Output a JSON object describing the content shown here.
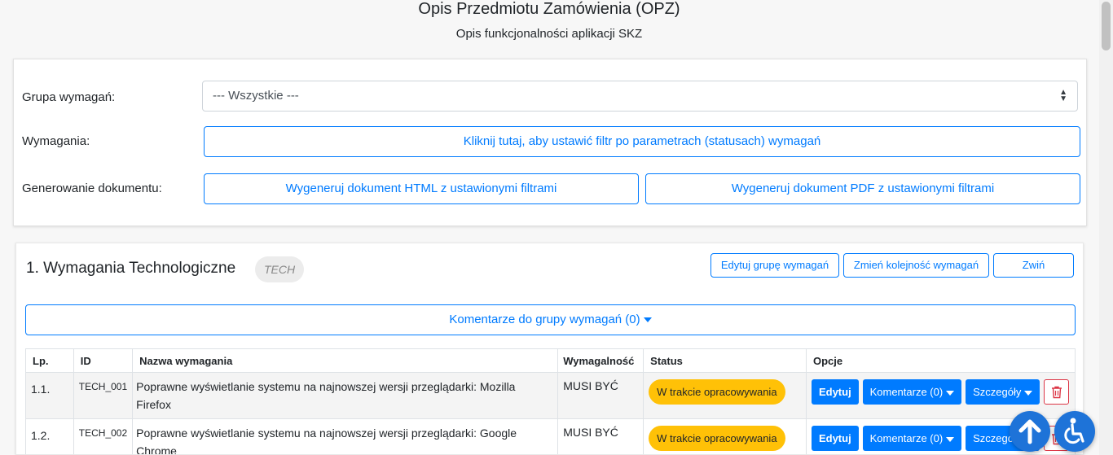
{
  "header": {
    "title": "Opis Przedmiotu Zamówienia (OPZ)",
    "subtitle": "Opis funkcjonalności aplikacji SKZ"
  },
  "filters": {
    "group_label": "Grupa wymagań:",
    "group_select_value": "--- Wszystkie ---",
    "requirements_label": "Wymagania:",
    "requirements_filter_button": "Kliknij tutaj, aby ustawić filtr po parametrach (statusach) wymagań",
    "generate_label": "Generowanie dokumentu:",
    "generate_html_button": "Wygeneruj dokument HTML z ustawionymi filtrami",
    "generate_pdf_button": "Wygeneruj dokument PDF z ustawionymi filtrami"
  },
  "group": {
    "title": "1. Wymagania Technologiczne",
    "badge": "TECH",
    "edit_button": "Edytuj grupę wymagań",
    "reorder_button": "Zmień kolejność wymagań",
    "collapse_button": "Zwiń",
    "comments_button": "Komentarze do grupy wymagań (0)"
  },
  "table": {
    "columns": [
      "Lp.",
      "ID",
      "Nazwa wymagania",
      "Wymagalność",
      "Status",
      "Opcje"
    ],
    "rows": [
      {
        "lp": "1.1.",
        "id": "TECH_001",
        "name": "Poprawne wyświetlanie systemu na najnowszej wersji przeglądarki: Mozilla Firefox",
        "requirement": "MUSI BYĆ",
        "status": "W trakcie opracowywania",
        "edit": "Edytuj",
        "comments": "Komentarze (0)",
        "details": "Szczegóły"
      },
      {
        "lp": "1.2.",
        "id": "TECH_002",
        "name": "Poprawne wyświetlanie systemu na najnowszej wersji przeglądarki: Google Chrome",
        "requirement": "MUSI BYĆ",
        "status": "W trakcie opracowywania",
        "edit": "Edytuj",
        "comments": "Komentarze (0)",
        "details": "Szczegóły"
      }
    ]
  },
  "colors": {
    "primary": "#007bff",
    "status_warning": "#ffc107",
    "danger": "#dc3545",
    "fab": "#1e73d8"
  },
  "icons": {
    "scroll_top": "arrow-up-icon",
    "accessibility": "wheelchair-icon",
    "delete": "trash-icon",
    "select_arrow": "sort-arrows-icon",
    "dropdown": "caret-down-icon"
  }
}
